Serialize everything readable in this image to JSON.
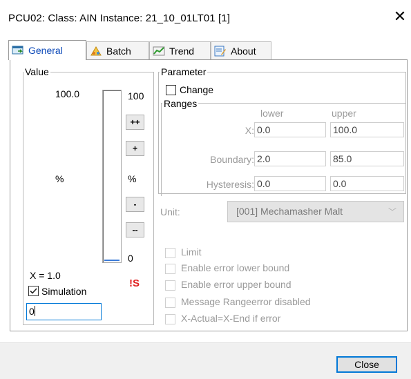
{
  "window": {
    "title": "PCU02: Class: AIN Instance: 21_10_01LT01 [1]",
    "close_glyph": "✕"
  },
  "tabs": [
    {
      "label": "General",
      "icon": "general-tab-icon",
      "active": true
    },
    {
      "label": "Batch",
      "icon": "batch-tab-icon",
      "active": false
    },
    {
      "label": "Trend",
      "icon": "trend-tab-icon",
      "active": false
    },
    {
      "label": "About",
      "icon": "about-tab-icon",
      "active": false
    }
  ],
  "value_group": {
    "title": "Value",
    "bar_top_value": "100.0",
    "scale_top": "100",
    "scale_bottom": "0",
    "unit_left": "%",
    "unit_right": "%",
    "bar_fill_fraction": 0.01,
    "buttons": {
      "plus_plus": "++",
      "plus": "+",
      "minus": "-",
      "minus_minus": "--"
    },
    "x_readout": "X = 1.0",
    "sim_badge": "!S",
    "simulation_label": "Simulation",
    "simulation_checked": true,
    "input_value": "0"
  },
  "parameter_group": {
    "title": "Parameter",
    "change_label": "Change",
    "change_checked": false
  },
  "ranges_group": {
    "title": "Ranges",
    "col_lower": "lower",
    "col_upper": "upper",
    "rows": [
      {
        "label": "X:",
        "lower": "0.0",
        "upper": "100.0"
      },
      {
        "label": "Boundary:",
        "lower": "2.0",
        "upper": "85.0"
      },
      {
        "label": "Hysteresis:",
        "lower": "0.0",
        "upper": "0.0"
      }
    ]
  },
  "unit": {
    "label": "Unit:",
    "selected": "[001] Mechamasher Malt",
    "caret": "﹀"
  },
  "options": [
    {
      "label": "Limit",
      "checked": false
    },
    {
      "label": "Enable error lower bound",
      "checked": false
    },
    {
      "label": "Enable error upper bound",
      "checked": false
    },
    {
      "label": "Message Rangeerror disabled",
      "checked": false
    },
    {
      "label": "X-Actual=X-End if error",
      "checked": false
    }
  ],
  "footer": {
    "close_label": "Close"
  },
  "colors": {
    "accent": "#0078d7",
    "active_tab_text": "#0b48b8",
    "sim_badge": "#e02020",
    "trend_green": "#2e9b2e"
  }
}
